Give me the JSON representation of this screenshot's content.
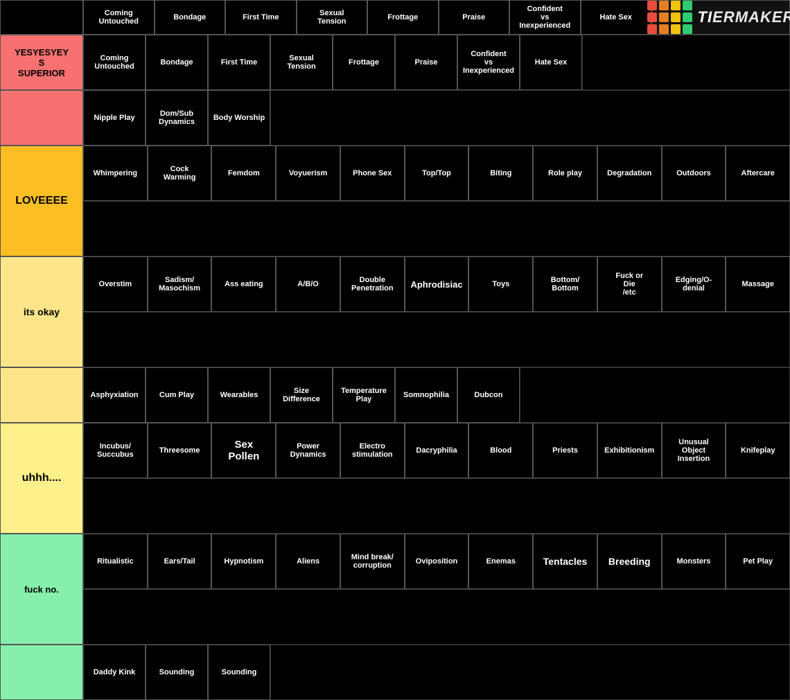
{
  "logo": {
    "text": "TiERMAKER",
    "dots": [
      "#e74c3c",
      "#e67e22",
      "#f1c40f",
      "#2ecc71",
      "#e74c3c",
      "#e67e22",
      "#f1c40f",
      "#2ecc71",
      "#e74c3c",
      "#e67e22",
      "#f1c40f",
      "#2ecc71"
    ]
  },
  "header": {
    "cols": [
      "Coming\nUntouched",
      "Bondage",
      "First Time",
      "Sexual\nTension",
      "Frottage",
      "Praise",
      "Confident\nvs\nInexperienced",
      "Hate Sex"
    ]
  },
  "tiers": [
    {
      "id": "s",
      "label": "YESYESYEY\nS\nSUPERIOR",
      "color": "#f87171",
      "rows": [
        [
          "Coming\nUntouched",
          "Bondage",
          "First Time",
          "Sexual\nTension",
          "Frottage",
          "Praise",
          "Confident\nvs\nInexperienced",
          "Hate Sex",
          "",
          "",
          "",
          ""
        ],
        [
          "Nipple Play",
          "Dom/Sub\nDynamics",
          "Body Worship",
          "",
          "",
          "",
          "",
          "",
          "",
          "",
          "",
          ""
        ]
      ]
    },
    {
      "id": "a",
      "label": "LOVEEEE",
      "color": "#fbbf24",
      "rows": [
        [
          "Whimpering",
          "Cock\nWarming",
          "Femdom",
          "Voyuerism",
          "Phone Sex",
          "Top/Top",
          "Biting",
          "Role play",
          "Degradation",
          "Outdoors",
          "Aftercare",
          ""
        ]
      ]
    },
    {
      "id": "b",
      "label": "its okay",
      "color": "#fde68a",
      "rows": [
        [
          "Overstim",
          "Sadism/\nMasochism",
          "Ass eating",
          "A/B/O",
          "Double\nPenetration",
          "Aphrodisiac",
          "Toys",
          "Bottom/\nBottom",
          "Fuck or\nDie\n/etc",
          "Edging/O-\ndenial",
          "Massage",
          ""
        ],
        [
          "Asphyxiation",
          "Cum Play",
          "Wearables",
          "Size\nDifference",
          "Temperature\nPlay",
          "Somnophilia",
          "Dubcon",
          "",
          "",
          "",
          "",
          ""
        ]
      ]
    },
    {
      "id": "c",
      "label": "uhhh....",
      "color": "#fef08a",
      "rows": [
        [
          "Incubus/\nSuccubus",
          "Threesome",
          "Sex\nPollen",
          "Power\nDynamics",
          "Electro\nstimulation",
          "Dacryphilia",
          "Blood",
          "Priests",
          "Exhibitionism",
          "Unusual\nObject\nInsertion",
          "Knifeplay",
          ""
        ]
      ]
    },
    {
      "id": "d",
      "label": "fuck no.",
      "color": "#86efac",
      "rows": [
        [
          "Ritualistic",
          "Ears/Tail",
          "Hypnotism",
          "Aliens",
          "Mind break/\ncorruption",
          "Oviposition",
          "Enemas",
          "Tentacles",
          "Breeding",
          "Monsters",
          "Pet Play",
          ""
        ],
        [
          "Daddy Kink",
          "Sounding",
          "Sounding",
          "",
          "",
          "",
          "",
          "",
          "",
          "",
          "",
          ""
        ]
      ]
    }
  ]
}
